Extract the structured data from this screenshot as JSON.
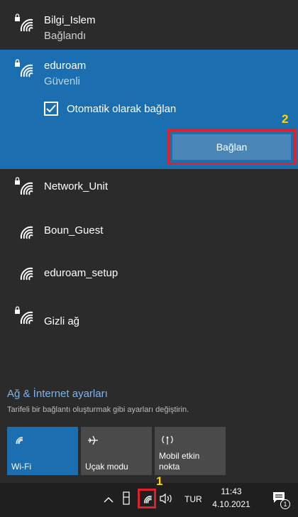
{
  "networks": [
    {
      "name": "Bilgi_Islem",
      "status": "Bağlandı",
      "secured": true
    },
    {
      "name": "eduroam",
      "status": "Güvenli",
      "secured": true
    },
    {
      "name": "Network_Unit",
      "status": "",
      "secured": true
    },
    {
      "name": "Boun_Guest",
      "status": "",
      "secured": false
    },
    {
      "name": "eduroam_setup",
      "status": "",
      "secured": false
    },
    {
      "name": "Gizli ağ",
      "status": "",
      "secured": true
    }
  ],
  "auto_connect_label": "Otomatik olarak bağlan",
  "auto_connect_checked": true,
  "connect_button": "Bağlan",
  "annotations": {
    "step1": "1",
    "step2": "2"
  },
  "settings": {
    "link": "Ağ & İnternet ayarları",
    "description": "Tarifeli bir bağlantı oluşturmak gibi ayarları değiştirin."
  },
  "quick_actions": [
    {
      "label": "Wi-Fi",
      "active": true,
      "icon": "wifi-icon"
    },
    {
      "label": "Uçak modu",
      "active": false,
      "icon": "airplane-icon"
    },
    {
      "label": "Mobil etkin nokta",
      "active": false,
      "icon": "hotspot-icon"
    }
  ],
  "taskbar": {
    "language": "TUR",
    "time": "11:43",
    "date": "4.10.2021",
    "notification_count": "1"
  },
  "colors": {
    "accent": "#1b6fb1",
    "highlight": "#e0202a",
    "annotation": "#ffd700"
  }
}
